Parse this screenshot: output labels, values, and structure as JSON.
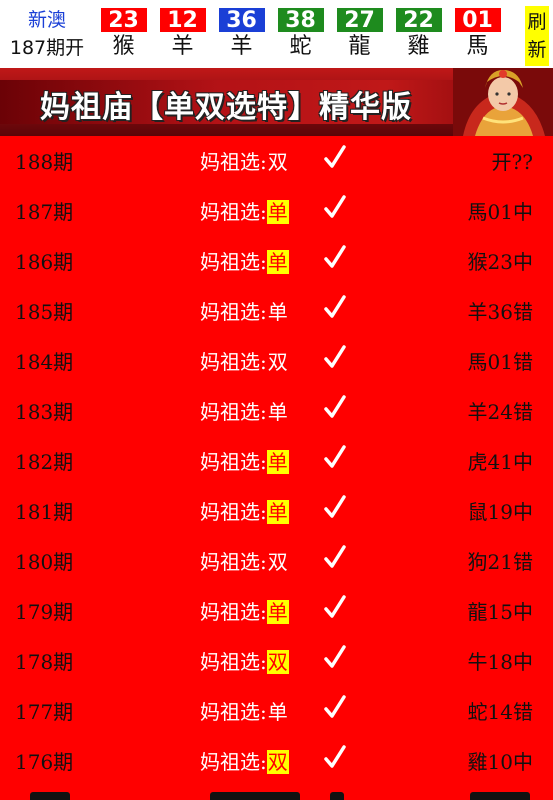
{
  "header": {
    "lottery_name": "新澳",
    "draw_issue": "187期开",
    "balls": [
      {
        "number": "23",
        "zodiac": "猴",
        "color": "#ff0000"
      },
      {
        "number": "12",
        "zodiac": "羊",
        "color": "#ff0000"
      },
      {
        "number": "36",
        "zodiac": "羊",
        "color": "#1a3fd6"
      },
      {
        "number": "38",
        "zodiac": "蛇",
        "color": "#1e8b1e"
      },
      {
        "number": "27",
        "zodiac": "龍",
        "color": "#1e8b1e"
      },
      {
        "number": "22",
        "zodiac": "雞",
        "color": "#1e8b1e"
      },
      {
        "number": "01",
        "zodiac": "馬",
        "color": "#ff0000"
      }
    ],
    "refresh": {
      "line1": "刷",
      "line2": "新"
    }
  },
  "banner": {
    "title": "妈祖庙【单双选特】精华版"
  },
  "rows": [
    {
      "issue": "188期",
      "label": "妈祖选:",
      "value": "双",
      "highlight": false,
      "result": "开??"
    },
    {
      "issue": "187期",
      "label": "妈祖选:",
      "value": "单",
      "highlight": true,
      "result": "馬01中"
    },
    {
      "issue": "186期",
      "label": "妈祖选:",
      "value": "单",
      "highlight": true,
      "result": "猴23中"
    },
    {
      "issue": "185期",
      "label": "妈祖选:",
      "value": "单",
      "highlight": false,
      "result": "羊36错"
    },
    {
      "issue": "184期",
      "label": "妈祖选:",
      "value": "双",
      "highlight": false,
      "result": "馬01错"
    },
    {
      "issue": "183期",
      "label": "妈祖选:",
      "value": "单",
      "highlight": false,
      "result": "羊24错"
    },
    {
      "issue": "182期",
      "label": "妈祖选:",
      "value": "单",
      "highlight": true,
      "result": "虎41中"
    },
    {
      "issue": "181期",
      "label": "妈祖选:",
      "value": "单",
      "highlight": true,
      "result": "鼠19中"
    },
    {
      "issue": "180期",
      "label": "妈祖选:",
      "value": "双",
      "highlight": false,
      "result": "狗21错"
    },
    {
      "issue": "179期",
      "label": "妈祖选:",
      "value": "单",
      "highlight": true,
      "result": "龍15中"
    },
    {
      "issue": "178期",
      "label": "妈祖选:",
      "value": "双",
      "highlight": true,
      "result": "牛18中"
    },
    {
      "issue": "177期",
      "label": "妈祖选:",
      "value": "单",
      "highlight": false,
      "result": "蛇14错"
    },
    {
      "issue": "176期",
      "label": "妈祖选:",
      "value": "双",
      "highlight": true,
      "result": "雞10中"
    }
  ],
  "colors": {
    "page_bg": "#ff0000",
    "highlight_bg": "#ffff00",
    "header_blue": "#1a3fd6"
  },
  "icons": {
    "check": "check-icon",
    "banner_image": "goddess-portrait-icon"
  }
}
